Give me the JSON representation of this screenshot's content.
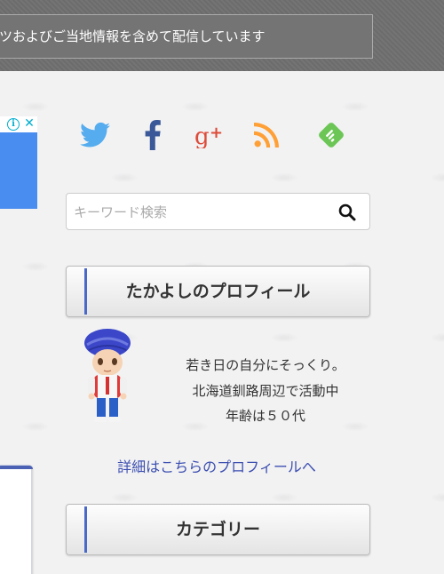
{
  "header": {
    "tagline": "ツおよびご当地情報を含めて配信しています"
  },
  "ad": {
    "info_icon": "info-icon",
    "close_icon": "close-icon",
    "info_glyph": "i",
    "close_glyph": "✕"
  },
  "social": [
    {
      "name": "twitter",
      "icon": "twitter-icon",
      "color": "#55acee"
    },
    {
      "name": "facebook",
      "icon": "facebook-icon",
      "color": "#3b5998"
    },
    {
      "name": "google-plus",
      "icon": "google-plus-icon",
      "color": "#dd4b39"
    },
    {
      "name": "rss",
      "icon": "rss-icon",
      "color": "#ffa036"
    },
    {
      "name": "feedly",
      "icon": "feedly-icon",
      "color": "#6cc655"
    }
  ],
  "search": {
    "placeholder": "キーワード検索",
    "value": "",
    "button_icon": "search-icon"
  },
  "profile_widget": {
    "title": "たかよしのプロフィール",
    "lines": [
      "若き日の自分にそっくり。",
      "北海道釧路周辺で活動中",
      "年齢は５０代"
    ],
    "link_text": "詳細はこちらのプロフィールへ"
  },
  "category_widget": {
    "title": "カテゴリー"
  },
  "colors": {
    "header_bg": "#6f6f6f",
    "accent": "#4a68c8",
    "link": "#3c4fb0"
  }
}
